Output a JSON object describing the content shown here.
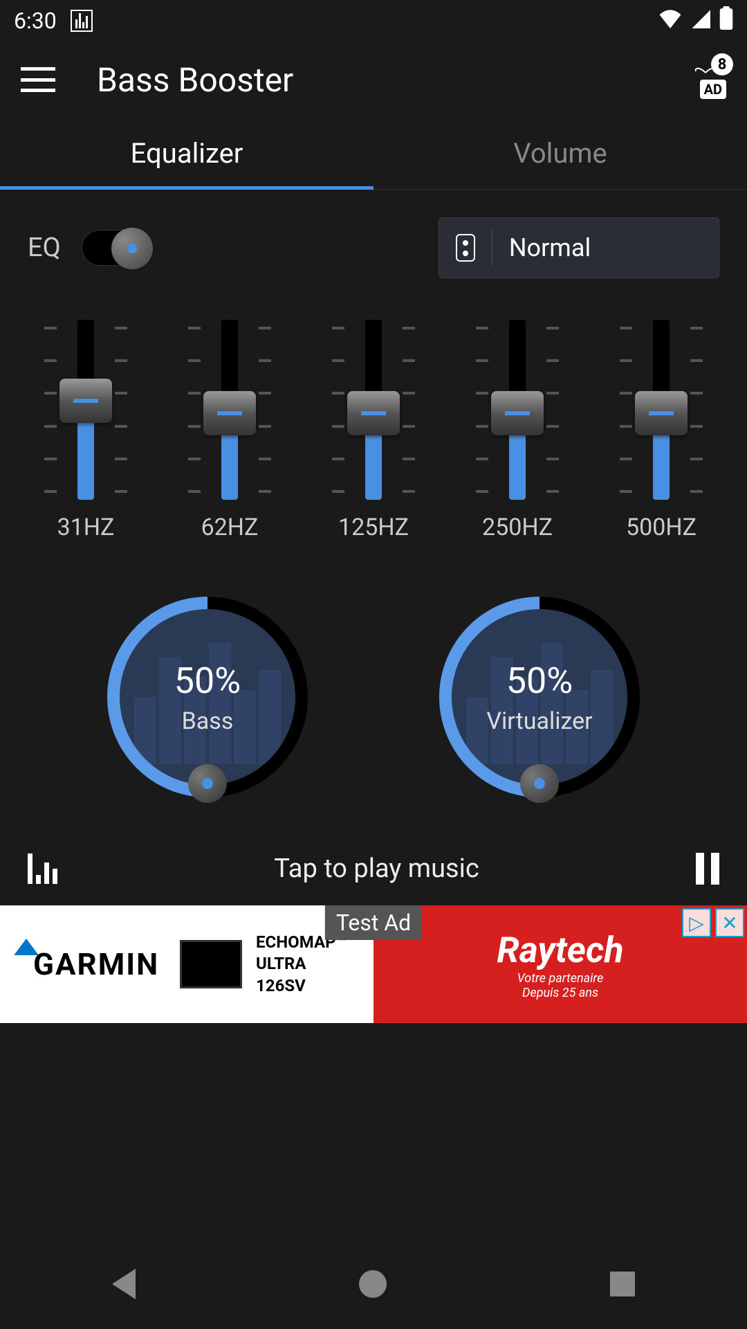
{
  "status_bar": {
    "time": "6:30"
  },
  "header": {
    "title": "Bass Booster",
    "ad_badge_count": "8",
    "ad_label": "AD"
  },
  "tabs": {
    "equalizer": "Equalizer",
    "volume": "Volume"
  },
  "eq": {
    "label": "EQ",
    "preset": "Normal"
  },
  "sliders": [
    {
      "label": "31HZ",
      "value": 55
    },
    {
      "label": "62HZ",
      "value": 48
    },
    {
      "label": "125HZ",
      "value": 48
    },
    {
      "label": "250HZ",
      "value": 48
    },
    {
      "label": "500HZ",
      "value": 48
    }
  ],
  "knobs": {
    "bass": {
      "value": "50%",
      "label": "Bass"
    },
    "virtualizer": {
      "value": "50%",
      "label": "Virtualizer"
    }
  },
  "play_bar": {
    "text": "Tap to play music"
  },
  "ad": {
    "test_label": "Test Ad",
    "garmin": "GARMIN",
    "product_line1": "ECHOMAP™",
    "product_line2": "ULTRA 126SV",
    "brand": "Raytech",
    "tagline1": "Votre partenaire",
    "tagline2": "Depuis 25 ans"
  }
}
